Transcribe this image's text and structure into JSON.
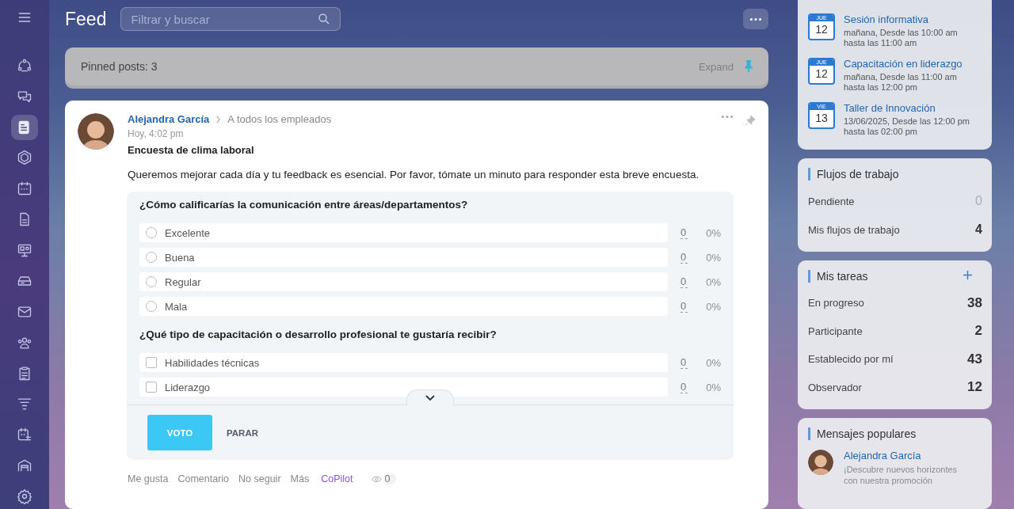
{
  "sidebar": {
    "items": [
      {
        "kind": "menu",
        "selected": false
      },
      {
        "kind": "cycle",
        "selected": false
      },
      {
        "kind": "chat",
        "selected": false
      },
      {
        "kind": "feed",
        "selected": true
      },
      {
        "kind": "hexagon",
        "selected": false
      },
      {
        "kind": "calendar",
        "selected": false
      },
      {
        "kind": "document",
        "selected": false
      },
      {
        "kind": "board",
        "selected": false
      },
      {
        "kind": "drive",
        "selected": false
      },
      {
        "kind": "mail",
        "selected": false
      },
      {
        "kind": "people",
        "selected": false
      },
      {
        "kind": "task",
        "selected": false
      },
      {
        "kind": "funnel",
        "selected": false
      },
      {
        "kind": "schedule",
        "selected": false
      },
      {
        "kind": "garage",
        "selected": false
      },
      {
        "kind": "settings",
        "selected": false
      }
    ]
  },
  "header": {
    "title": "Feed",
    "search": {
      "placeholder": "Filtrar y buscar"
    }
  },
  "pinned": {
    "label": "Pinned posts: 3",
    "expand": "Expand"
  },
  "post": {
    "author": "Alejandra García",
    "recipient": "A todos los empleados",
    "time": "Hoy, 4:02 pm",
    "title": "Encuesta de clima laboral",
    "body": "Queremos mejorar cada día y tu feedback es esencial. Por favor, tómate un minuto para responder esta breve encuesta.",
    "questions": [
      {
        "text": "¿Cómo calificarías la comunicación entre áreas/departamentos?",
        "kind": "radio",
        "options": [
          {
            "label": "Excelente",
            "checked": false,
            "count": "0",
            "percent": "0%"
          },
          {
            "label": "Buena",
            "checked": false,
            "count": "0",
            "percent": "0%"
          },
          {
            "label": "Regular",
            "checked": false,
            "count": "0",
            "percent": "0%"
          },
          {
            "label": "Mala",
            "checked": false,
            "count": "0",
            "percent": "0%"
          }
        ]
      },
      {
        "text": "¿Qué tipo de capacitación o desarrollo profesional te gustaría recibir?",
        "kind": "checkbox",
        "options": [
          {
            "label": "Habilidades técnicas",
            "checked": false,
            "count": "0",
            "percent": "0%"
          },
          {
            "label": "Liderazgo",
            "checked": false,
            "count": "0",
            "percent": "0%"
          }
        ]
      }
    ],
    "vote": "VOTO",
    "stop": "PARAR",
    "actions": [
      "Me gusta",
      "Comentario",
      "No seguir",
      "Más"
    ],
    "copilot": "CoPilot",
    "views": "0"
  },
  "events": [
    {
      "weekday": "JUE",
      "day": "12",
      "title": "Sesión informativa",
      "when": "mañana, Desde las 10:00 am",
      "until": "hasta las 11:00 am"
    },
    {
      "weekday": "JUE",
      "day": "12",
      "title": "Capacitación en liderazgo",
      "when": "mañana, Desde las 11:00 am",
      "until": "hasta las 12:00 pm"
    },
    {
      "weekday": "VIE",
      "day": "13",
      "title": "Taller de Innovación",
      "when": "13/06/2025, Desde las 12:00 pm",
      "until": "hasta las 02:00 pm"
    }
  ],
  "workflows": {
    "title": "Flujos de trabajo",
    "rows": [
      {
        "label": "Pendiente",
        "count": "0",
        "dimmed": true
      },
      {
        "label": "Mis flujos de trabajo",
        "count": "4",
        "dimmed": false
      }
    ]
  },
  "tasks": {
    "title": "Mis tareas",
    "rows": [
      {
        "label": "En progreso",
        "count": "38",
        "dimmed": false
      },
      {
        "label": "Participante",
        "count": "2",
        "dimmed": false
      },
      {
        "label": "Establecido por mí",
        "count": "43",
        "dimmed": false
      },
      {
        "label": "Observador",
        "count": "12",
        "dimmed": false
      }
    ]
  },
  "popular": {
    "title": "Mensajes populares",
    "author": "Alejandra García",
    "lines": [
      "¡Descubre nuevos horizontes",
      "con nuestra promoción"
    ]
  }
}
